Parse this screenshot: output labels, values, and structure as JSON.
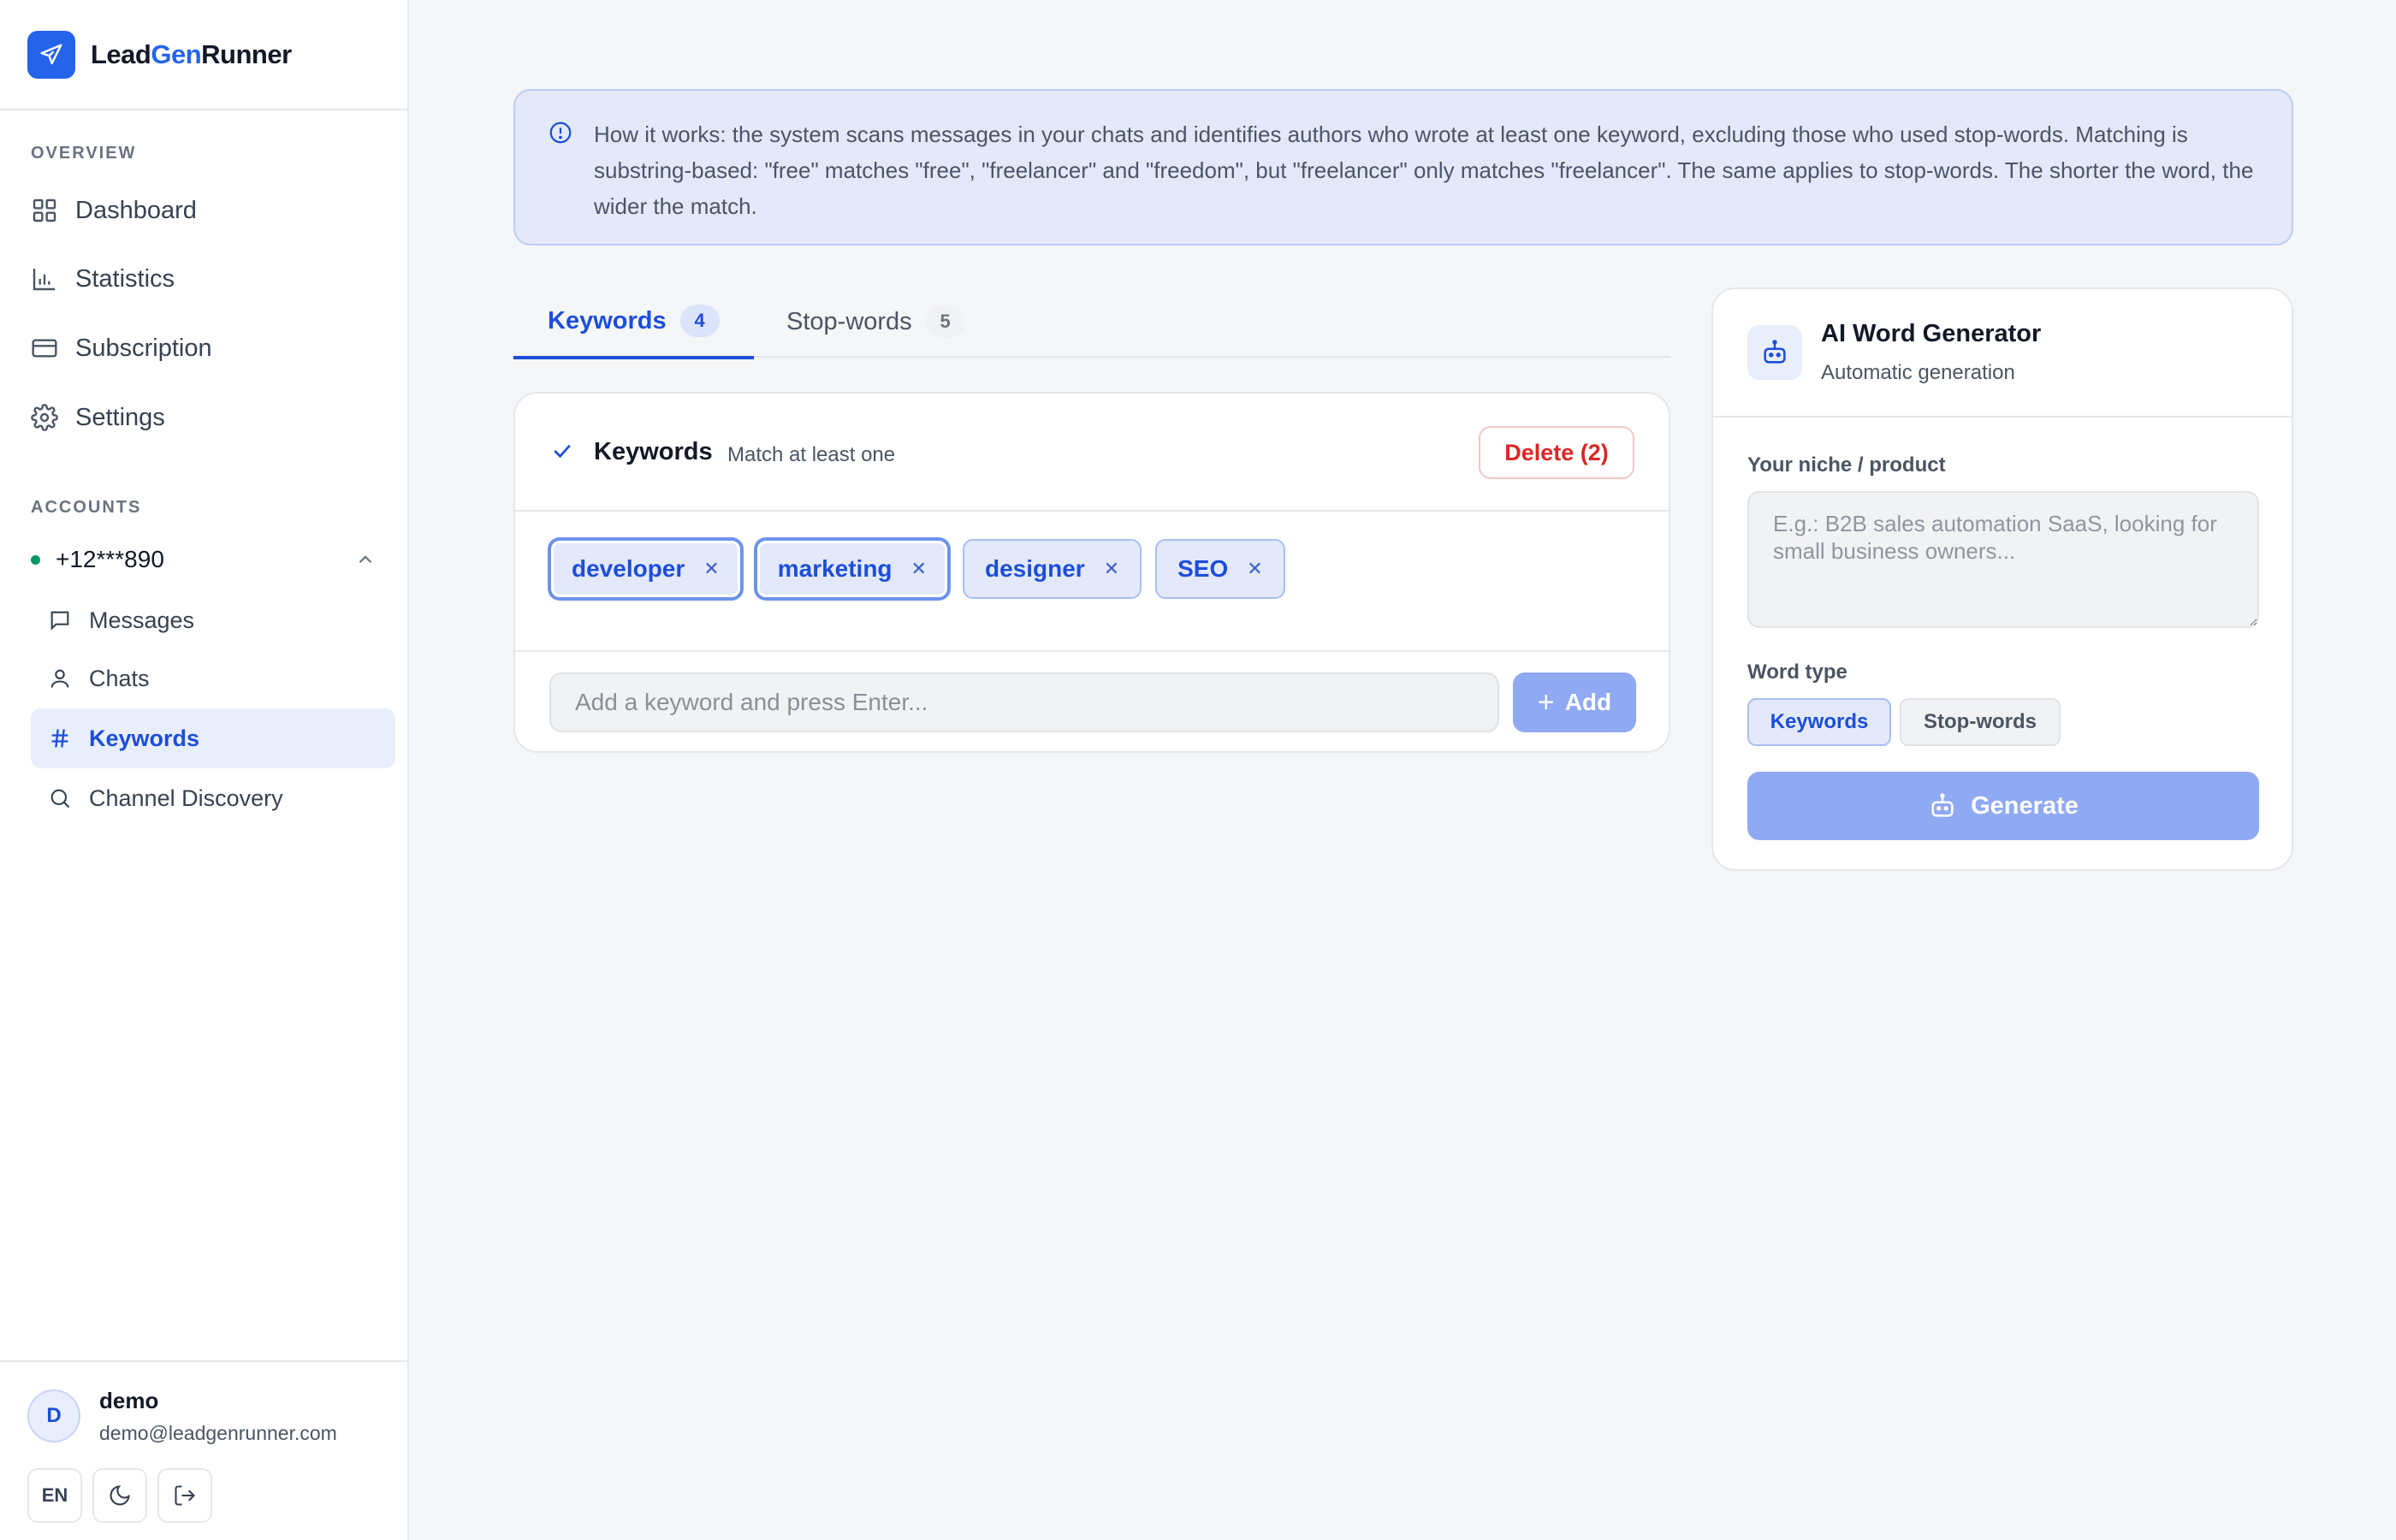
{
  "brand": {
    "part1": "Lead",
    "part2": "Gen",
    "part3": "Runner"
  },
  "sidebar": {
    "overview_label": "OVERVIEW",
    "nav": [
      {
        "label": "Dashboard",
        "icon": "grid-icon"
      },
      {
        "label": "Statistics",
        "icon": "bar-chart-icon"
      },
      {
        "label": "Subscription",
        "icon": "credit-card-icon"
      },
      {
        "label": "Settings",
        "icon": "gear-icon"
      }
    ],
    "accounts_label": "ACCOUNTS",
    "account": {
      "phone": "+12***890",
      "status_color": "#059669"
    },
    "sub_items": [
      {
        "label": "Messages",
        "icon": "message-icon"
      },
      {
        "label": "Chats",
        "icon": "user-icon"
      },
      {
        "label": "Keywords",
        "icon": "hash-icon",
        "active": true
      },
      {
        "label": "Channel Discovery",
        "icon": "search-icon"
      }
    ],
    "user": {
      "initial": "D",
      "name": "demo",
      "email": "demo@leadgenrunner.com"
    },
    "footer": {
      "lang": "EN"
    }
  },
  "info": {
    "text": "How it works: the system scans messages in your chats and identifies authors who wrote at least one keyword, excluding those who used stop-words. Matching is substring-based: \"free\" matches \"free\", \"freelancer\" and \"freedom\", but \"freelancer\" only matches \"freelancer\". The same applies to stop-words. The shorter the word, the wider the match."
  },
  "tabs": [
    {
      "label": "Keywords",
      "count": "4",
      "active": true
    },
    {
      "label": "Stop-words",
      "count": "5",
      "active": false
    }
  ],
  "keywords_card": {
    "title": "Keywords",
    "subtitle": "Match at least one",
    "delete_label": "Delete (2)",
    "chips": [
      {
        "label": "developer",
        "selected": true
      },
      {
        "label": "marketing",
        "selected": true
      },
      {
        "label": "designer",
        "selected": false
      },
      {
        "label": "SEO",
        "selected": false
      }
    ],
    "input_placeholder": "Add a keyword and press Enter...",
    "add_label": "Add"
  },
  "ai_card": {
    "title": "AI Word Generator",
    "subtitle": "Automatic generation",
    "niche_label": "Your niche / product",
    "niche_placeholder": "E.g.: B2B sales automation SaaS, looking for small business owners...",
    "word_type_label": "Word type",
    "word_type_options": [
      "Keywords",
      "Stop-words"
    ],
    "selected_word_type": "Keywords",
    "generate_label": "Generate"
  },
  "colors": {
    "accent": "#2563eb",
    "danger": "#dc2626",
    "success": "#059669"
  }
}
